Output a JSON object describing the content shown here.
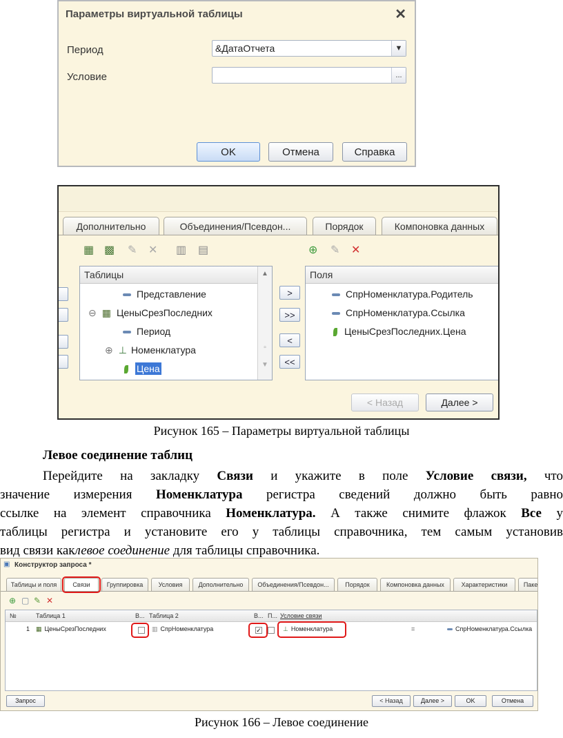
{
  "dialog1": {
    "title": "Параметры виртуальной таблицы",
    "close_glyph": "✕",
    "period_label": "Период",
    "period_value": "&ДатаОтчета",
    "condition_label": "Условие",
    "condition_value": "",
    "dropdown_glyph": "▼",
    "ellipsis_glyph": "...",
    "ok": "OK",
    "cancel": "Отмена",
    "help": "Справка"
  },
  "dialog2": {
    "tabs": [
      "Дополнительно",
      "Объединения/Псевдон...",
      "Порядок",
      "Компоновка данных"
    ],
    "tables_header": "Таблицы",
    "fields_header": "Поля",
    "tree": [
      {
        "label": "Представление",
        "level": 2,
        "icon": "field"
      },
      {
        "label": "ЦеныСрезПоследних",
        "level": 1,
        "icon": "table"
      },
      {
        "label": "Период",
        "level": 2,
        "icon": "field"
      },
      {
        "label": "Номенклатура",
        "level": 2,
        "icon": "link"
      },
      {
        "label": "Цена",
        "level": 2,
        "icon": "resource",
        "selected": true
      }
    ],
    "fields": [
      {
        "label": "СпрНоменклатура.Родитель",
        "icon": "field"
      },
      {
        "label": "СпрНоменклатура.Ссылка",
        "icon": "field"
      },
      {
        "label": "ЦеныСрезПоследних.Цена",
        "icon": "resource"
      }
    ],
    "move_buttons": [
      ">",
      ">>",
      "<",
      "<<"
    ],
    "back": "< Назад",
    "next": "Далее >"
  },
  "caption1": "Рисунок 165 – Параметры виртуальной таблицы",
  "heading": "Левое соединение таблиц",
  "para": {
    "l1a": "Перейдите на закладку ",
    "l1b": "Связи",
    "l1c": " и укажите в поле ",
    "l1d": "Условие связи,",
    "l1e": " что",
    "l2a": "значение измерения ",
    "l2b": "Номенклатура",
    "l2c": " регистра сведений должно быть равно",
    "l3a": "ссылке на элемент справочника ",
    "l3b": "Номенклатура.",
    "l3c": " А также снимите флажок ",
    "l3d": "Все",
    "l3e": " у",
    "l4": "таблицы регистра и установите его у таблицы справочника, тем самым установив",
    "l5a": "вид связи как",
    "l5b": "левое соединение",
    "l5c": " для таблицы справочника."
  },
  "dialog3": {
    "title": "Конструктор запроса *",
    "tabs": [
      "Таблицы и поля",
      "Связи",
      "Группировка",
      "Условия",
      "Дополнительно",
      "Объединения/Псевдон...",
      "Порядок",
      "Компоновка данных",
      "Характеристики",
      "Пакет"
    ],
    "columns": {
      "num": "№",
      "table1": "Таблица 1",
      "all1": "В...",
      "table2": "Таблица 2",
      "all2": "В...",
      "p": "П...",
      "condition": "Условие связи"
    },
    "row": {
      "num": "1",
      "table1": "ЦеныСрезПоследних",
      "table2": "СпрНоменклатура",
      "left": "Номенклатура",
      "op": "=",
      "right": "СпрНоменклатура.Ссылка"
    },
    "query_button": "Запрос",
    "back": "< Назад",
    "next": "Далее >",
    "ok": "OK",
    "cancel": "Отмена"
  },
  "caption2": "Рисунок 166 – Левое соединение"
}
